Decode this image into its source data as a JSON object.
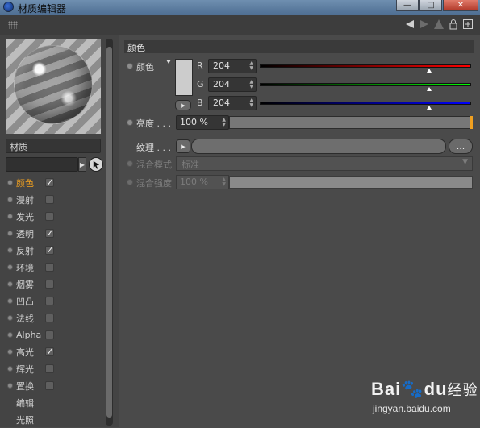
{
  "window": {
    "title": "材质编辑器",
    "buttons": {
      "min": "—",
      "max": "□",
      "close": "✕"
    }
  },
  "preview": {
    "name_field": "材质"
  },
  "channels": [
    {
      "label": "颜色",
      "checked": true,
      "active": true
    },
    {
      "label": "漫射",
      "checked": false
    },
    {
      "label": "发光",
      "checked": false
    },
    {
      "label": "透明",
      "checked": true
    },
    {
      "label": "反射",
      "checked": true
    },
    {
      "label": "环境",
      "checked": false
    },
    {
      "label": "烟雾",
      "checked": false
    },
    {
      "label": "凹凸",
      "checked": false
    },
    {
      "label": "法线",
      "checked": false
    },
    {
      "label": "Alpha",
      "checked": false
    },
    {
      "label": "高光",
      "checked": true
    },
    {
      "label": "辉光",
      "checked": false
    },
    {
      "label": "置换",
      "checked": false
    },
    {
      "label": "编辑",
      "checked": null
    },
    {
      "label": "光照",
      "checked": null
    }
  ],
  "color_section": {
    "header": "颜色",
    "color_label": "颜色",
    "swatch_color": "#cccccc",
    "rgb": [
      {
        "letter": "R",
        "value": "204",
        "fraction": 0.8,
        "gradient": [
          "#000000",
          "#ff0000"
        ]
      },
      {
        "letter": "G",
        "value": "204",
        "fraction": 0.8,
        "gradient": [
          "#000000",
          "#00ff00"
        ]
      },
      {
        "letter": "B",
        "value": "204",
        "fraction": 0.8,
        "gradient": [
          "#000000",
          "#0000ff"
        ]
      }
    ],
    "brightness_label": "亮度 . . .",
    "brightness_value": "100 %",
    "texture_label": "纹理 . . .",
    "texture_more": "...",
    "blend_mode_label": "混合模式",
    "blend_mode_value": "标准",
    "blend_strength_label": "混合强度",
    "blend_strength_value": "100 %"
  },
  "accent_color": "#f0a020",
  "watermark": {
    "brand": "Bai",
    "brand2": "du",
    "suffix": "经验",
    "url": "jingyan.baidu.com"
  }
}
